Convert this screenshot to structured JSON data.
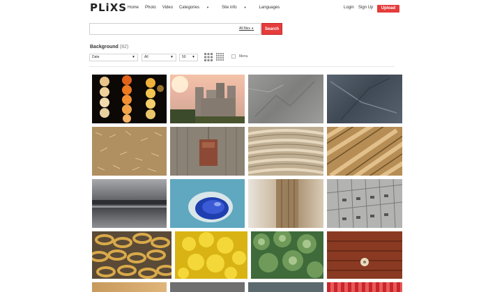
{
  "header": {
    "logo": "PLiXS",
    "nav": [
      {
        "label": "Home",
        "dropdown": false
      },
      {
        "label": "Photo",
        "dropdown": false
      },
      {
        "label": "Video",
        "dropdown": false
      },
      {
        "label": "Categories",
        "dropdown": true
      },
      {
        "label": "Site info",
        "dropdown": true
      },
      {
        "label": "Languages",
        "dropdown": false
      }
    ],
    "login": "Login",
    "signup": "Sign Up",
    "upload": "Upload"
  },
  "search": {
    "placeholder": "",
    "scope": "All files",
    "button": "Search"
  },
  "section": {
    "title": "Background",
    "count": "(82)"
  },
  "filters": {
    "sort": "Date",
    "type": "All",
    "per_page": "50",
    "menu_label": "Menu"
  },
  "colors": {
    "accent": "#e53c3c"
  }
}
